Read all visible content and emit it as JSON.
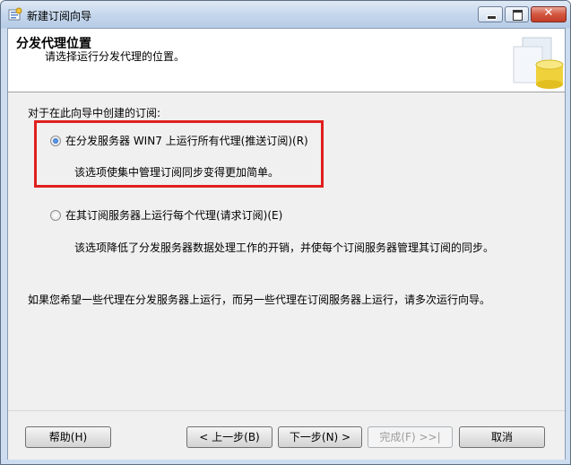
{
  "window": {
    "title": "新建订阅向导",
    "minimize_glyph": "",
    "maximize_glyph": "",
    "close_glyph": "✕"
  },
  "header": {
    "title": "分发代理位置",
    "subtitle": "请选择运行分发代理的位置。"
  },
  "main": {
    "group_label": "对于在此向导中创建的订阅:",
    "options": [
      {
        "label": "在分发服务器 WIN7 上运行所有代理(推送订阅)(R)",
        "description": "该选项使集中管理订阅同步变得更加简单。",
        "selected": true
      },
      {
        "label": "在其订阅服务器上运行每个代理(请求订阅)(E)",
        "description": "该选项降低了分发服务器数据处理工作的开销，并使每个订阅服务器管理其订阅的同步。",
        "selected": false
      }
    ],
    "footnote": "如果您希望一些代理在分发服务器上运行，而另一些代理在订阅服务器上运行，请多次运行向导。"
  },
  "footer": {
    "help": "帮助(H)",
    "back": "< 上一步(B)",
    "next": "下一步(N) >",
    "finish": "完成(F) >>|",
    "cancel": "取消"
  },
  "colors": {
    "highlight_box": "#e0201e",
    "radio_selected": "#1d5fbf"
  }
}
